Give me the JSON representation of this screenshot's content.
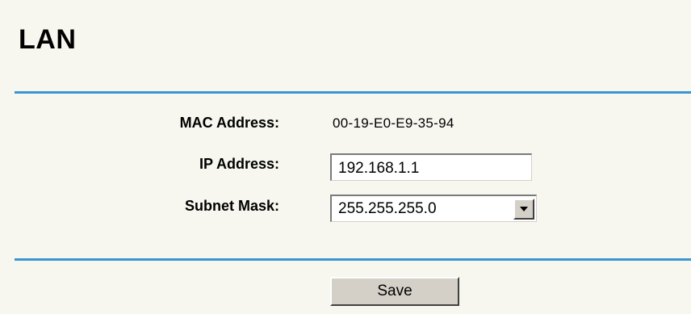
{
  "page": {
    "title": "LAN"
  },
  "form": {
    "mac_label": "MAC Address:",
    "mac_value": "00-19-E0-E9-35-94",
    "ip_label": "IP Address:",
    "ip_value": "192.168.1.1",
    "mask_label": "Subnet Mask:",
    "mask_value": "255.255.255.0"
  },
  "actions": {
    "save_label": "Save"
  },
  "colors": {
    "panel_background": "#f7f7f0",
    "rule_color": "#3a96d3",
    "button_face": "#d4d0c8"
  },
  "icons": {
    "select_dropdown": "chevron-down-icon"
  }
}
